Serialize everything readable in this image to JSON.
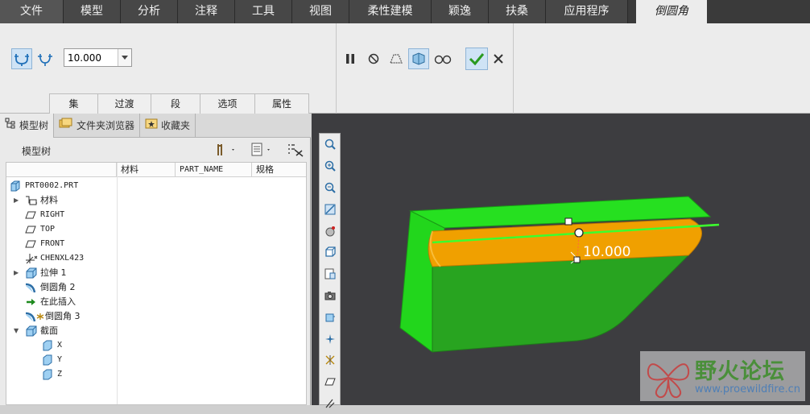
{
  "menu": {
    "tabs": [
      "文件",
      "模型",
      "分析",
      "注释",
      "工具",
      "视图",
      "柔性建模",
      "颖逸",
      "扶桑",
      "应用程序"
    ],
    "active_tab": "倒圆角"
  },
  "ribbon": {
    "radius_value": "10.000",
    "subtabs": [
      "集",
      "过渡",
      "段",
      "选项",
      "属性"
    ]
  },
  "left_panel": {
    "nav_tabs": [
      "模型树",
      "文件夹浏览器",
      "收藏夹"
    ],
    "tree_title": "模型树",
    "columns": [
      "材料",
      "PART_NAME",
      "规格"
    ],
    "tree": [
      {
        "label": "PRT0002.PRT"
      },
      {
        "label": "材料"
      },
      {
        "label": "RIGHT"
      },
      {
        "label": "TOP"
      },
      {
        "label": "FRONT"
      },
      {
        "label": "CHENXL423"
      },
      {
        "label": "拉伸 1"
      },
      {
        "label": "倒圆角 2"
      },
      {
        "label": "在此插入"
      },
      {
        "label": "倒圆角 3"
      },
      {
        "label": "截面"
      },
      {
        "label": "X"
      },
      {
        "label": "Y"
      },
      {
        "label": "Z"
      }
    ]
  },
  "graphics": {
    "dimension_label": "10.000"
  },
  "watermark": {
    "title": "野火论坛",
    "url": "www.proewildfire.cn"
  },
  "colors": {
    "model_green": "#22d61c",
    "round_orange": "#f0a000",
    "background": "#3d3d40"
  }
}
